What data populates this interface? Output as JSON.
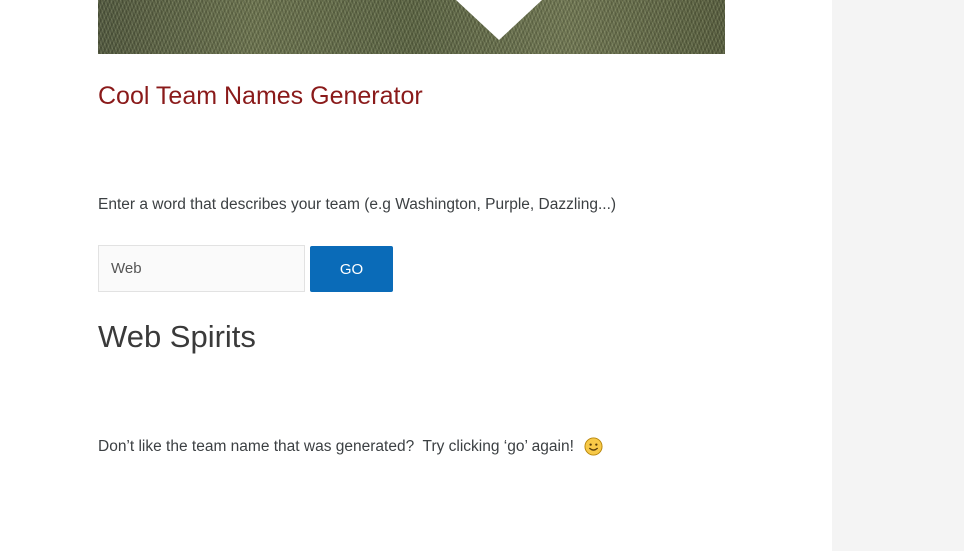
{
  "hero": {
    "icon": "grass-banner-image"
  },
  "title": "Cool Team Names Generator",
  "instruction": "Enter a word that describes your team (e.g Washington, Purple, Dazzling...)",
  "input": {
    "value": "Web"
  },
  "go_button": {
    "label": "GO",
    "color": "#0a6bb8"
  },
  "result": "Web Spirits",
  "retry_text": "Don’t like the team name that was generated?  Try clicking ‘go’ again!",
  "retry_icon": "smile-emoji-icon",
  "colors": {
    "title": "#8a1a1a",
    "sidebar": "#f4f4f4"
  }
}
